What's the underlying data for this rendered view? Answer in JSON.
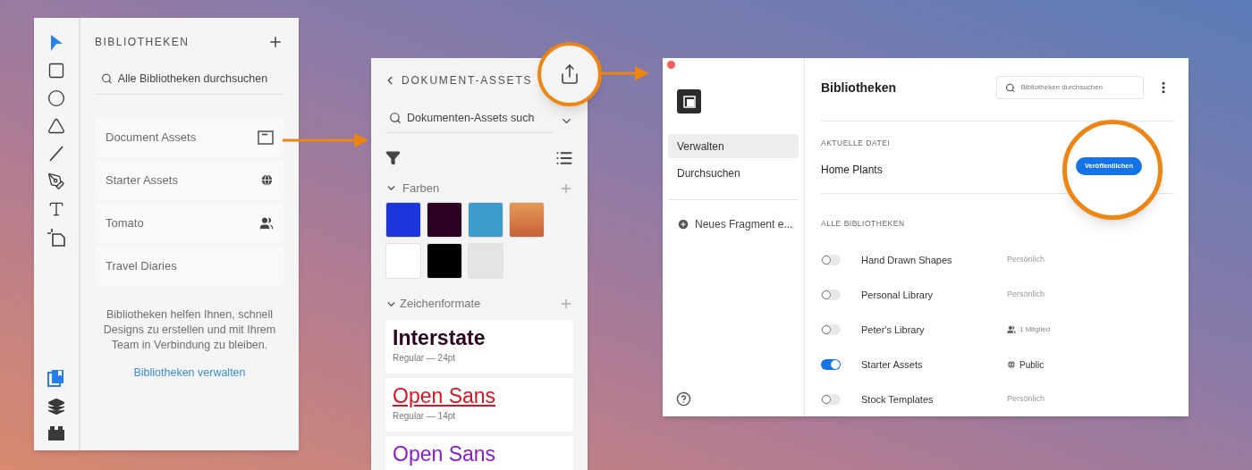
{
  "tools_panel": {
    "tools": [
      {
        "kind": "select",
        "selected": true
      },
      {
        "kind": "rectangle",
        "selected": false
      },
      {
        "kind": "ellipse",
        "selected": false
      },
      {
        "kind": "polygon",
        "selected": false
      },
      {
        "kind": "line",
        "selected": false
      },
      {
        "kind": "pen",
        "selected": false
      },
      {
        "kind": "text",
        "selected": false
      },
      {
        "kind": "artboard",
        "selected": false
      }
    ],
    "bottom_tools": [
      {
        "kind": "libraries",
        "selected": true
      },
      {
        "kind": "layers",
        "selected": false
      },
      {
        "kind": "plugins",
        "selected": false
      }
    ]
  },
  "libraries_panel": {
    "title": "BIBLIOTHEKEN",
    "search": {
      "placeholder": "Alle Bibliotheken durchsuchen"
    },
    "items": [
      {
        "name": "Document Assets",
        "kind": "document"
      },
      {
        "name": "Starter Assets",
        "kind": "public"
      },
      {
        "name": "Tomato",
        "kind": "shared"
      },
      {
        "name": "Travel Diaries",
        "kind": "none"
      }
    ],
    "help_text": "Bibliotheken helfen Ihnen, schnell Designs zu erstellen und mit Ihrem Team in Verbindung zu bleiben.",
    "link": "Bibliotheken verwalten"
  },
  "document_assets_panel": {
    "title": "DOKUMENT-ASSETS",
    "search": {
      "placeholder": "Dokumenten-Assets such"
    },
    "colors_section": {
      "label": "Farben",
      "expanded": true,
      "swatches": [
        {
          "color": "#1d35dc"
        },
        {
          "color": "#2c0020"
        },
        {
          "color": "#3d9ccb"
        },
        {
          "kind": "gradient",
          "color": "#e39a58"
        },
        {
          "color": "#ffffff"
        },
        {
          "color": "#000000"
        },
        {
          "color": "#e4e4e4"
        }
      ]
    },
    "styles_section": {
      "label": "Zeichenformate",
      "expanded": true,
      "styles": [
        {
          "name": "Interstate",
          "meta": "Regular — 24pt",
          "color": "#2c0020",
          "kind": "bold"
        },
        {
          "name": "Open Sans",
          "meta": "Regular — 14pt",
          "color": "#e01020",
          "kind": "underline"
        },
        {
          "name": "Open Sans",
          "color": "#8a18d8",
          "kind": "plain"
        }
      ]
    }
  },
  "manage_window": {
    "nav": [
      {
        "label": "Verwalten",
        "selected": true
      },
      {
        "label": "Durchsuchen",
        "selected": false
      }
    ],
    "new_fragment": "Neues Fragment e...",
    "title": "Bibliotheken",
    "search": {
      "placeholder": "Bibliotheken durchsuchen"
    },
    "current_file": {
      "label": "AKTUELLE DATEI",
      "name": "Home Plants",
      "button": "Veröffentlichen"
    },
    "all_libraries": {
      "label": "ALLE BIBLIOTHEKEN",
      "rows": [
        {
          "on": false,
          "name": "Hand Drawn Shapes",
          "sharing": "Persönlich",
          "kind": "personal"
        },
        {
          "on": false,
          "name": "Personal Library",
          "sharing": "Persönlich",
          "kind": "personal"
        },
        {
          "on": false,
          "name": "Peter's Library",
          "sharing": "1 Mitglied",
          "kind": "members"
        },
        {
          "on": true,
          "name": "Starter Assets",
          "sharing": "Public",
          "kind": "public"
        },
        {
          "on": false,
          "name": "Stock Templates",
          "sharing": "Persönlich",
          "kind": "personal"
        }
      ]
    }
  }
}
